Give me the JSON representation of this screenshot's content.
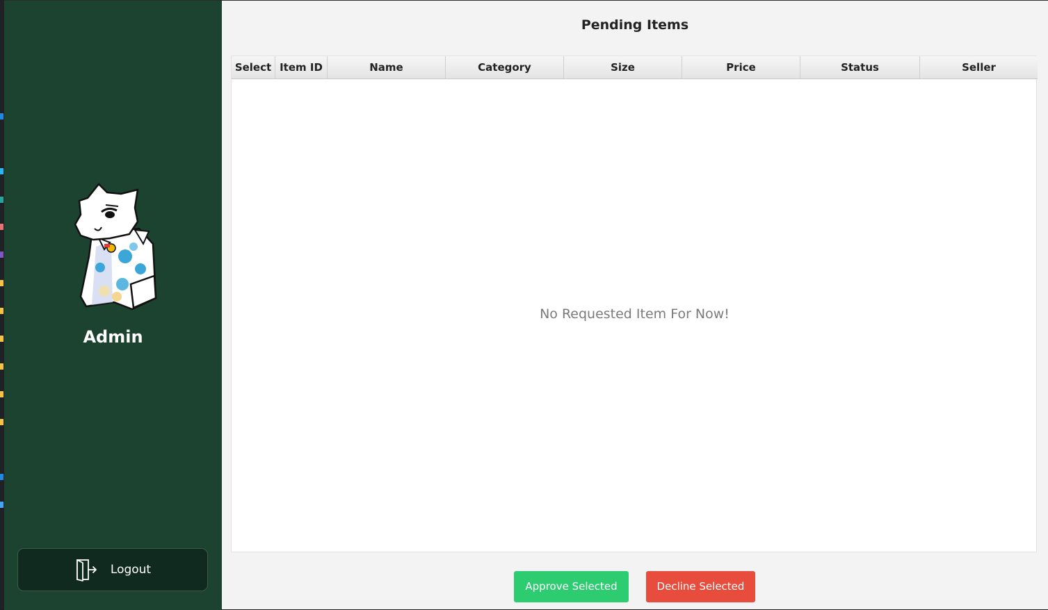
{
  "sidebar": {
    "user_name": "Admin",
    "avatar_icon": "white-cat-in-hawaiian-shirt-avatar",
    "logout_label": "Logout",
    "logout_icon": "door-exit-icon",
    "background_color": "#1c4230"
  },
  "main": {
    "title": "Pending Items",
    "table": {
      "columns": [
        "Select",
        "Item ID",
        "Name",
        "Category",
        "Size",
        "Price",
        "Status",
        "Seller"
      ],
      "rows": [],
      "empty_message": "No Requested Item For Now!"
    },
    "actions": {
      "approve_label": "Approve Selected",
      "decline_label": "Decline Selected",
      "approve_color": "#2ecc71",
      "decline_color": "#e74c3c"
    }
  }
}
